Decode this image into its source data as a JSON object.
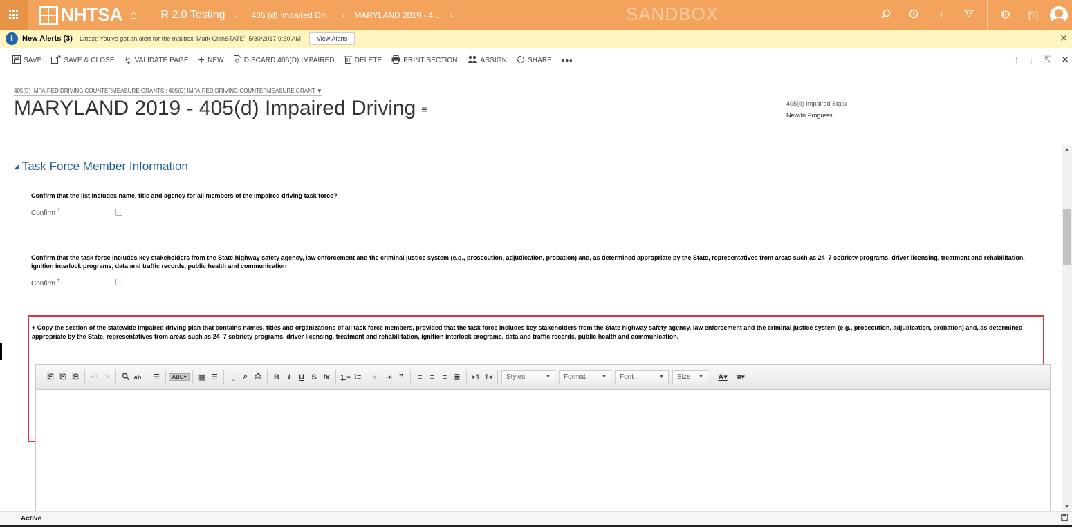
{
  "nav": {
    "brand": "NHTSA",
    "area": "R 2.0 Testing",
    "area_chevron": "⌄",
    "breadcrumb_1": "405 (d) Impaired Dri...",
    "breadcrumb_2": "MARYLAND 2019 - 4...",
    "breadcrumb_sep": "›",
    "environment": "SANDBOX",
    "accent_color": "#f4a35c"
  },
  "alert": {
    "title": "New Alerts (3)",
    "text": "Latest: You've got an alert for the mailbox 'Mark ChinSTATE'. 5/30/2017 9:50 AM",
    "button": "View Alerts"
  },
  "commands": {
    "save": "SAVE",
    "save_close": "SAVE & CLOSE",
    "validate": "VALIDATE PAGE",
    "new": "NEW",
    "discard": "DISCARD 405(D) IMPAIRED",
    "delete": "DELETE",
    "print": "PRINT SECTION",
    "assign": "ASSIGN",
    "share": "SHARE",
    "more": "•••"
  },
  "header": {
    "entity_label": "405(D) IMPAIRED DRIVING COUNTERMEASURE GRANTS : 405(D) IMPAIRED DRIVING COUNTERMEASURE GRANT",
    "title": "MARYLAND 2019 - 405(d) Impaired Driving",
    "field_label": "405(d) Impaired Statu",
    "field_value": "New/In Progress"
  },
  "section": {
    "title": "Task Force Member Information",
    "q1": "Confirm that the list includes name, title and agency for all members of the impaired driving task force?",
    "q1_label": "Confirm",
    "q2": "Confirm that the task force includes key stakeholders from the State highway safety agency, law enforcement and the criminal justice system (e.g., prosecution, adjudication, probation) and, as determined appropriate by the State, representatives from areas such as 24–7 sobriety programs, driver licensing, treatment and rehabilitation, ignition interlock programs, data and traffic records, public health and communication",
    "q2_label": "Confirm",
    "required_mark": "*",
    "q3": "+ Copy the section of the statewide impaired driving plan that contains names, titles and organizations of all task force members, provided that the task force includes key stakeholders from the State highway safety agency, law enforcement and the criminal justice system (e.g., prosecution, adjudication, probation) and, as determined appropriate by the State, representatives from areas such as 24–7 sobriety programs, driver licensing, treatment and rehabilitation, ignition interlock programs, data and traffic records, public health and communication."
  },
  "editor": {
    "styles": "Styles",
    "format": "Format",
    "font": "Font",
    "size": "Size"
  },
  "footer": {
    "status": "Active"
  }
}
